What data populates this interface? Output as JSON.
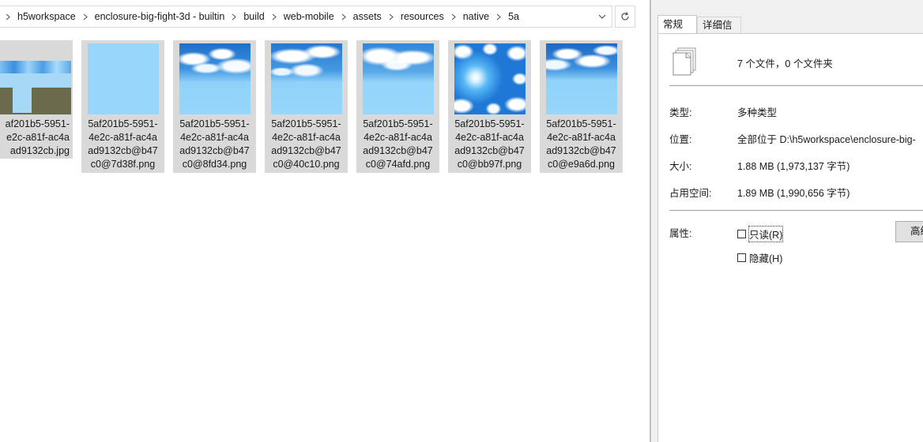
{
  "explorer": {
    "breadcrumb": [
      "h5workspace",
      "enclosure-big-fight-3d - builtin",
      "build",
      "web-mobile",
      "assets",
      "resources",
      "native",
      "5a"
    ],
    "files": [
      {
        "name_lines": "af201b5-5951-\ne2c-a81f-ac4a\nad9132cb.jpg",
        "thumb": "jpg"
      },
      {
        "name_lines": "5af201b5-5951-\n4e2c-a81f-ac4a\nad9132cb@b47\nc0@7d38f.png",
        "thumb": "sky-light"
      },
      {
        "name_lines": "5af201b5-5951-\n4e2c-a81f-ac4a\nad9132cb@b47\nc0@8fd34.png",
        "thumb": "sky-cloud"
      },
      {
        "name_lines": "5af201b5-5951-\n4e2c-a81f-ac4a\nad9132cb@b47\nc0@40c10.png",
        "thumb": "sky-cloud2"
      },
      {
        "name_lines": "5af201b5-5951-\n4e2c-a81f-ac4a\nad9132cb@b47\nc0@74afd.png",
        "thumb": "sky-cloud3"
      },
      {
        "name_lines": "5af201b5-5951-\n4e2c-a81f-ac4a\nad9132cb@b47\nc0@bb97f.png",
        "thumb": "sky-sun"
      },
      {
        "name_lines": "5af201b5-5951-\n4e2c-a81f-ac4a\nad9132cb@b47\nc0@e9a6d.png",
        "thumb": "sky-cloud4"
      }
    ]
  },
  "properties": {
    "tabs": {
      "general": "常规",
      "details": "详细信息"
    },
    "summary": "7 个文件，0 个文件夹",
    "type_label": "类型:",
    "type_value": "多种类型",
    "location_label": "位置:",
    "location_value": "全部位于 D:\\h5workspace\\enclosure-big-",
    "size_label": "大小:",
    "size_value": "1.88 MB (1,973,137 字节)",
    "disk_label": "占用空间:",
    "disk_value": "1.89 MB (1,990,656 字节)",
    "attributes_label": "属性:",
    "readonly_label": "只读(R)",
    "hidden_label": "隐藏(H)",
    "advanced_label": "高级"
  },
  "colors": {
    "tile_bg": "#d9d9d9",
    "sky_light": "#98d6fb",
    "panel_bg": "#f0f0f0"
  }
}
